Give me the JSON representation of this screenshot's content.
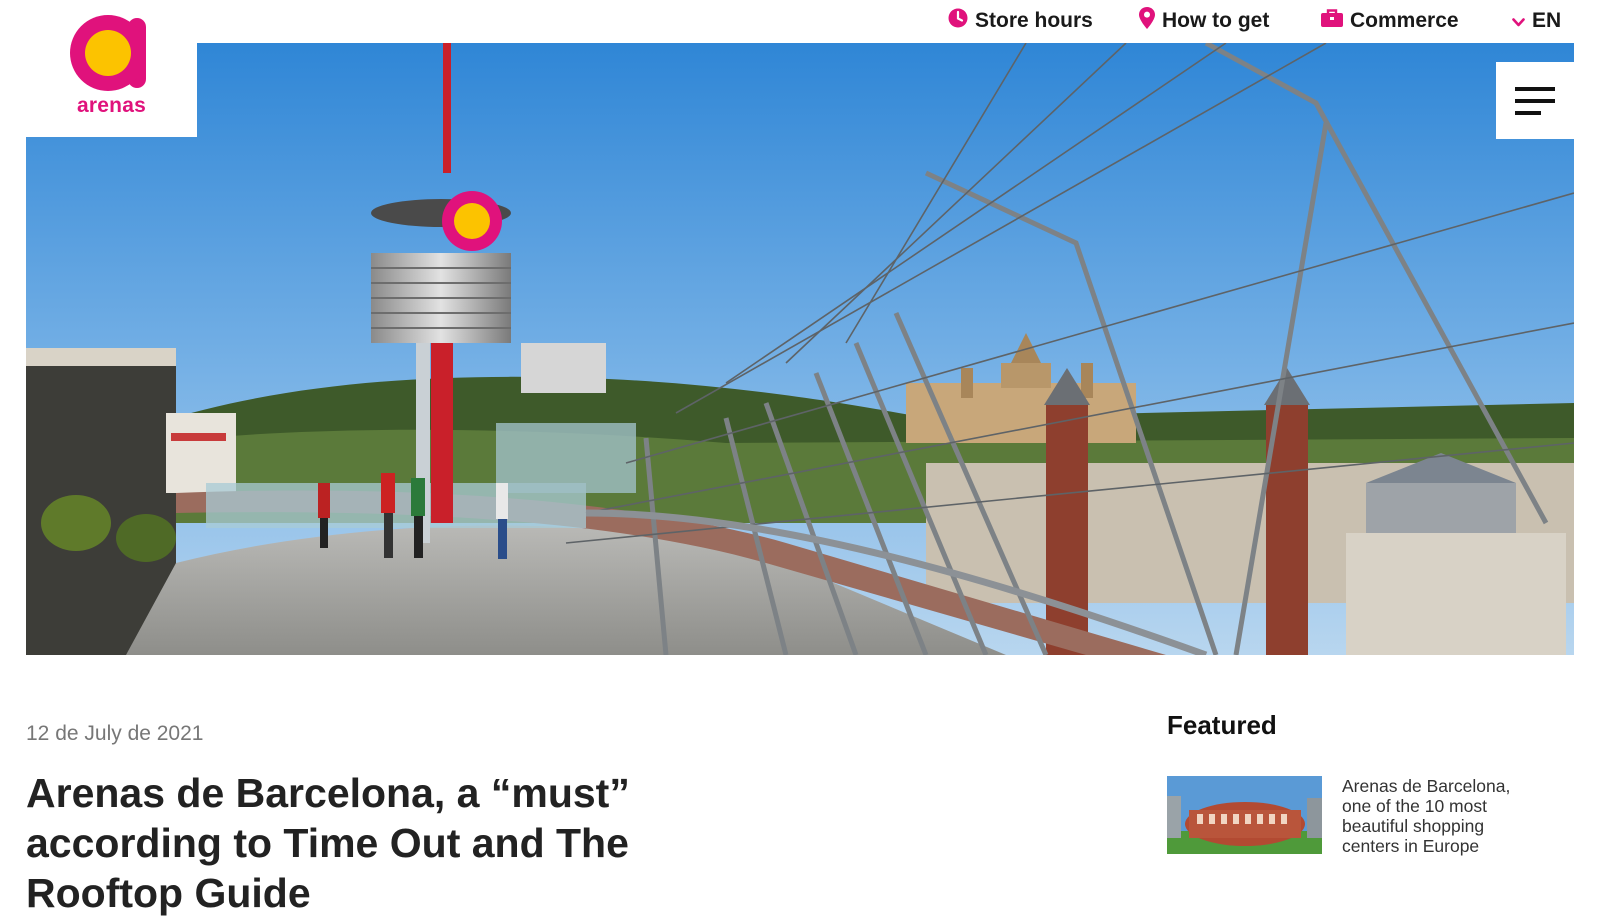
{
  "brand": {
    "name": "arenas",
    "color": "#e0127c",
    "accent": "#fcc300"
  },
  "nav": {
    "store_hours": "Store hours",
    "how_to_get": "How to get",
    "commerce": "Commerce",
    "language": "EN",
    "icons": {
      "store_hours": "clock-icon",
      "how_to_get": "location-pin-icon",
      "commerce": "shopping-bag-icon",
      "language": "chevron-down-icon"
    }
  },
  "menu": {
    "icon": "hamburger-menu-icon"
  },
  "hero": {
    "description_icon": "rooftop-photo"
  },
  "article": {
    "date": "12 de July de 2021",
    "title": "Arenas de Barcelona, a “must” according to Time Out and The Rooftop Guide"
  },
  "featured": {
    "heading": "Featured",
    "items": [
      {
        "text": "Arenas de Barcelona, one of the 10 most beautiful shopping centers in Europe"
      }
    ]
  }
}
